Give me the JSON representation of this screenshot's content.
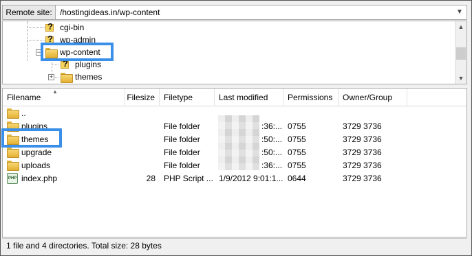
{
  "site_bar": {
    "label": "Remote site:",
    "path": "/hostingideas.in/wp-content",
    "dropdown_icon": "chevron-down-icon"
  },
  "tree": {
    "items": [
      {
        "label": "cgi-bin",
        "icon": "unknown-folder-icon"
      },
      {
        "label": "wp-admin",
        "icon": "unknown-folder-icon"
      },
      {
        "label": "wp-content",
        "icon": "folder-icon",
        "expanded": true,
        "highlighted": true
      },
      {
        "label": "plugins",
        "icon": "unknown-folder-icon"
      },
      {
        "label": "themes",
        "icon": "folder-icon",
        "expander": "+"
      }
    ]
  },
  "list": {
    "columns": [
      "Filename",
      "Filesize",
      "Filetype",
      "Last modified",
      "Permissions",
      "Owner/Group"
    ],
    "rows": [
      {
        "name": "..",
        "size": "",
        "type": "",
        "modified": "",
        "perm": "",
        "owner": "",
        "icon": "folder-icon"
      },
      {
        "name": "plugins",
        "size": "",
        "type": "File folder",
        "modified": ":36:...",
        "perm": "0755",
        "owner": "3729 3736",
        "icon": "folder-icon"
      },
      {
        "name": "themes",
        "size": "",
        "type": "File folder",
        "modified": ":50:...",
        "perm": "0755",
        "owner": "3729 3736",
        "icon": "folder-icon",
        "highlighted": true
      },
      {
        "name": "upgrade",
        "size": "",
        "type": "File folder",
        "modified": ":50:...",
        "perm": "0755",
        "owner": "3729 3736",
        "icon": "folder-icon"
      },
      {
        "name": "uploads",
        "size": "",
        "type": "File folder",
        "modified": ":36:...",
        "perm": "0755",
        "owner": "3729 3736",
        "icon": "folder-icon"
      },
      {
        "name": "index.php",
        "size": "28",
        "type": "PHP Script ...",
        "modified": "1/9/2012 9:01:1...",
        "perm": "0644",
        "owner": "3729 3736",
        "icon": "php-file-icon"
      }
    ]
  },
  "status": "1 file and 4 directories. Total size: 28 bytes",
  "colors": {
    "highlight": "#3a8fe8"
  }
}
